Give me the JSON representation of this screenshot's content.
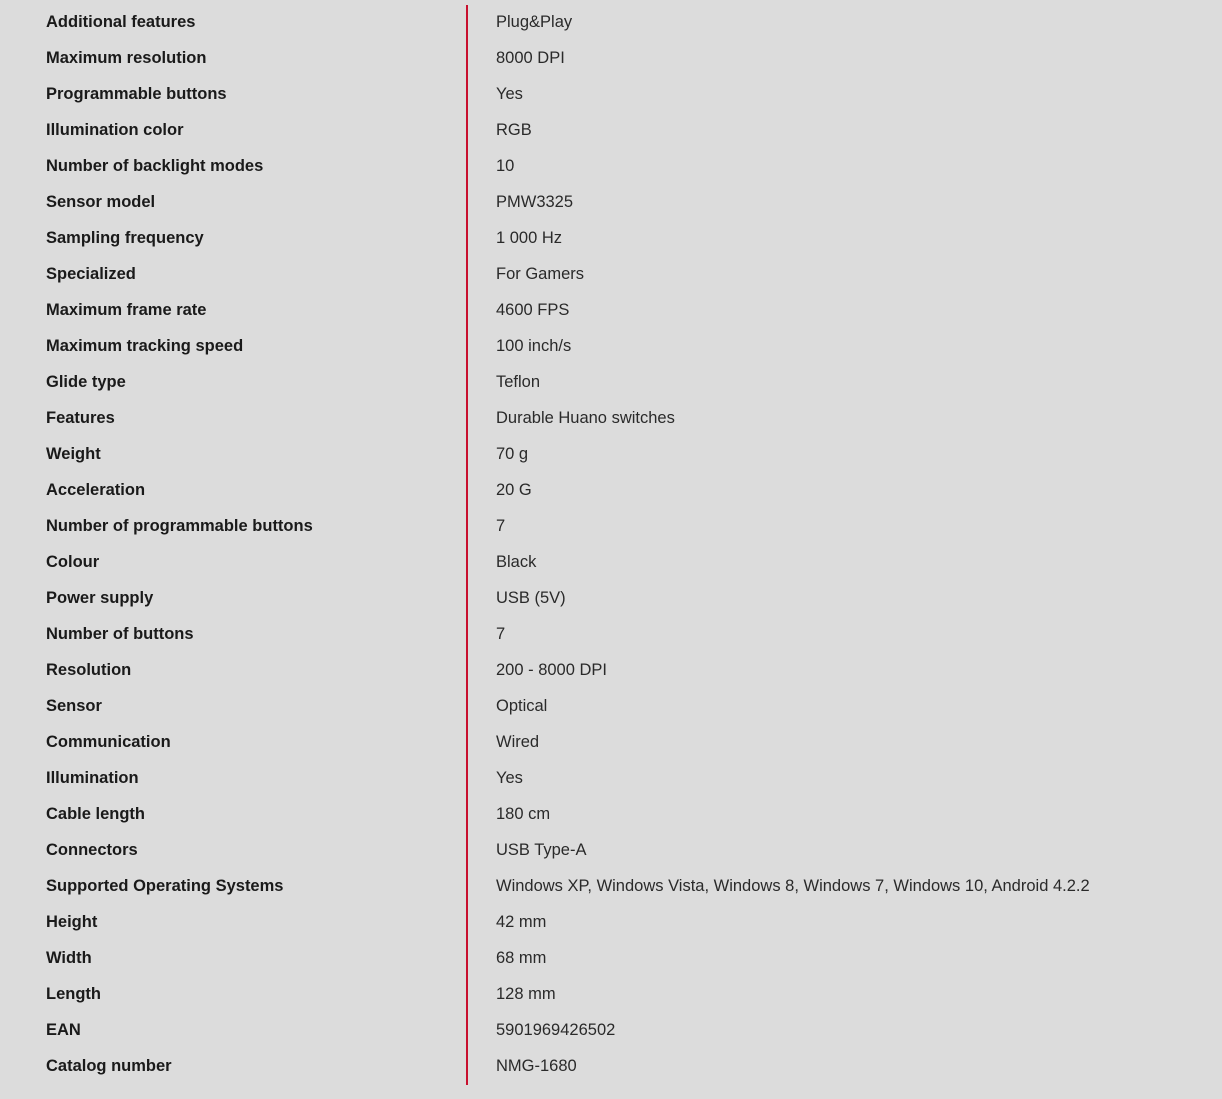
{
  "accent_color": "#c8102e",
  "specs": [
    {
      "label": "Additional features",
      "value": "Plug&Play"
    },
    {
      "label": "Maximum resolution",
      "value": "8000 DPI"
    },
    {
      "label": "Programmable buttons",
      "value": "Yes"
    },
    {
      "label": "Illumination color",
      "value": "RGB"
    },
    {
      "label": "Number of backlight modes",
      "value": "10"
    },
    {
      "label": "Sensor model",
      "value": "PMW3325"
    },
    {
      "label": "Sampling frequency",
      "value": "1 000 Hz"
    },
    {
      "label": "Specialized",
      "value": "For Gamers"
    },
    {
      "label": "Maximum frame rate",
      "value": "4600 FPS"
    },
    {
      "label": "Maximum tracking speed",
      "value": "100 inch/s"
    },
    {
      "label": "Glide type",
      "value": "Teflon"
    },
    {
      "label": "Features",
      "value": "Durable Huano switches"
    },
    {
      "label": "Weight",
      "value": "70 g"
    },
    {
      "label": "Acceleration",
      "value": "20 G"
    },
    {
      "label": "Number of programmable buttons",
      "value": "7"
    },
    {
      "label": "Colour",
      "value": "Black"
    },
    {
      "label": "Power supply",
      "value": "USB (5V)"
    },
    {
      "label": "Number of buttons",
      "value": "7"
    },
    {
      "label": "Resolution",
      "value": "200 - 8000 DPI"
    },
    {
      "label": "Sensor",
      "value": "Optical"
    },
    {
      "label": "Communication",
      "value": "Wired"
    },
    {
      "label": "Illumination",
      "value": "Yes"
    },
    {
      "label": "Cable length",
      "value": "180 cm"
    },
    {
      "label": "Connectors",
      "value": "USB Type-A"
    },
    {
      "label": "Supported Operating Systems",
      "value": "Windows XP, Windows Vista, Windows 8, Windows 7, Windows 10, Android 4.2.2"
    },
    {
      "label": "Height",
      "value": "42 mm"
    },
    {
      "label": "Width",
      "value": "68 mm"
    },
    {
      "label": "Length",
      "value": "128 mm"
    },
    {
      "label": "EAN",
      "value": "5901969426502"
    },
    {
      "label": "Catalog number",
      "value": "NMG-1680"
    }
  ]
}
